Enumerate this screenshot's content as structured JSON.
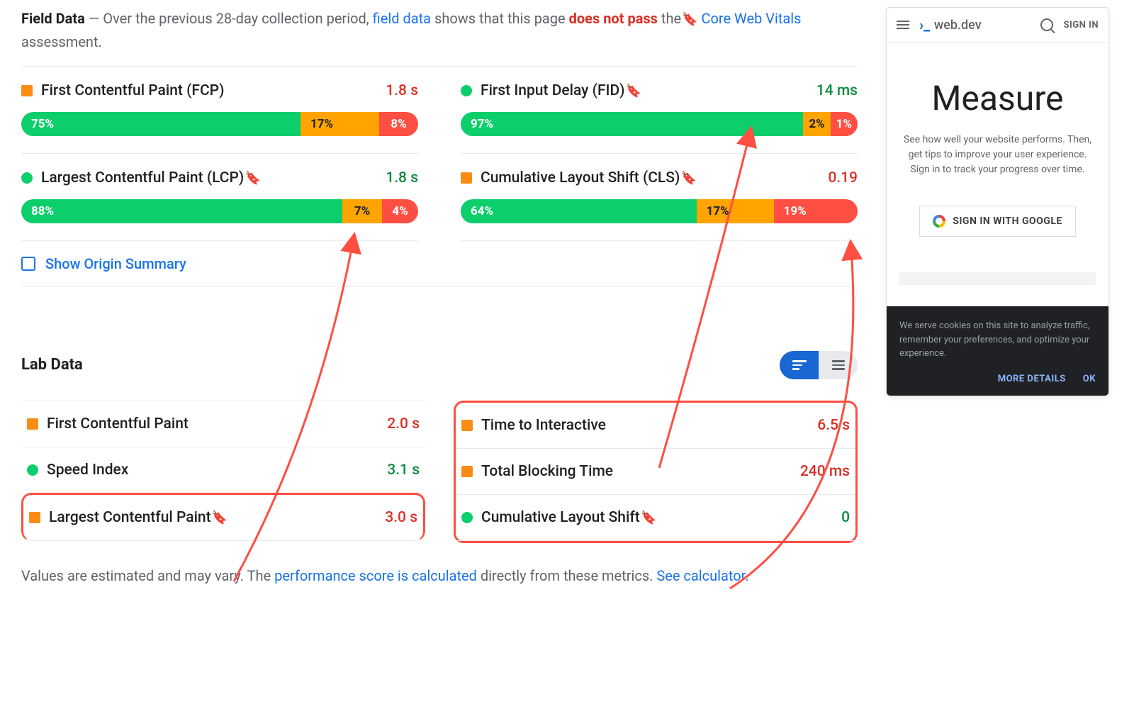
{
  "fieldData": {
    "title": "Field Data",
    "intro1": " — Over the previous 28-day collection period, ",
    "link1": "field data",
    "intro2": " shows that this page ",
    "fail": "does not pass",
    "intro3": " the ",
    "link2": "Core Web Vitals",
    "intro4": " assessment."
  },
  "metrics": [
    {
      "name": "First Contentful Paint (FCP)",
      "value": "1.8 s",
      "valueClass": "v-red",
      "dot": "square orange",
      "bookmark": false,
      "dist": [
        [
          "75%",
          "seg-green",
          75
        ],
        [
          "17%",
          "seg-orange",
          17
        ],
        [
          "8%",
          "seg-red narrow",
          8
        ]
      ]
    },
    {
      "name": "First Input Delay (FID)",
      "value": "14 ms",
      "valueClass": "v-green",
      "dot": "circle green",
      "bookmark": true,
      "dist": [
        [
          "97%",
          "seg-green",
          94
        ],
        [
          "2%",
          "seg-orange narrow",
          3
        ],
        [
          "1%",
          "seg-red narrow",
          3
        ]
      ]
    },
    {
      "name": "Largest Contentful Paint (LCP)",
      "value": "1.8 s",
      "valueClass": "v-green",
      "dot": "circle green",
      "bookmark": true,
      "dist": [
        [
          "88%",
          "seg-green",
          85
        ],
        [
          "7%",
          "seg-orange narrow",
          8
        ],
        [
          "4%",
          "seg-red narrow",
          7
        ]
      ]
    },
    {
      "name": "Cumulative Layout Shift (CLS)",
      "value": "0.19",
      "valueClass": "v-red",
      "dot": "square orange",
      "bookmark": true,
      "dist": [
        [
          "64%",
          "seg-green",
          64
        ],
        [
          "17%",
          "seg-orange",
          17
        ],
        [
          "19%",
          "seg-red",
          19
        ]
      ]
    }
  ],
  "originSummary": "Show Origin Summary",
  "labTitle": "Lab Data",
  "lab": {
    "col1": [
      {
        "name": "First Contentful Paint",
        "value": "2.0 s",
        "dot": "square orange",
        "vc": "v-red",
        "bm": false,
        "hl": false
      },
      {
        "name": "Speed Index",
        "value": "3.1 s",
        "dot": "circle green",
        "vc": "v-green",
        "bm": false,
        "hl": false
      },
      {
        "name": "Largest Contentful Paint",
        "value": "3.0 s",
        "dot": "square orange",
        "vc": "v-red",
        "bm": true,
        "hl": true
      }
    ],
    "col2": [
      {
        "name": "Time to Interactive",
        "value": "6.5 s",
        "dot": "square orange",
        "vc": "v-red",
        "bm": false
      },
      {
        "name": "Total Blocking Time",
        "value": "240 ms",
        "dot": "square orange",
        "vc": "v-red",
        "bm": false
      },
      {
        "name": "Cumulative Layout Shift",
        "value": "0",
        "dot": "circle green",
        "vc": "v-green",
        "bm": true
      }
    ]
  },
  "footer": {
    "t1": "Values are estimated and may vary. The ",
    "l1": "performance score is calculated",
    "t2": " directly from these metrics. ",
    "l2": "See calculator."
  },
  "phone": {
    "brand": "web.dev",
    "signin": "SIGN IN",
    "heading": "Measure",
    "desc": "See how well your website performs. Then, get tips to improve your user experience. Sign in to track your progress over time.",
    "button": "SIGN IN WITH GOOGLE",
    "cookie": "We serve cookies on this site to analyze traffic, remember your preferences, and optimize your experience.",
    "more": "MORE DETAILS",
    "ok": "OK"
  }
}
